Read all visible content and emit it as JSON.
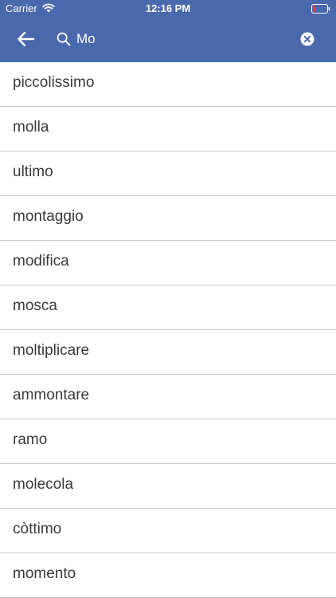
{
  "status_bar": {
    "carrier": "Carrier",
    "time": "12:16 PM"
  },
  "search": {
    "query": "Mo",
    "icons": {
      "back": "arrow-left-icon",
      "search": "search-icon",
      "clear": "clear-circle-icon"
    }
  },
  "results": [
    "piccolissimo",
    "molla",
    "ultimo",
    "montaggio",
    "modifica",
    "mosca",
    "moltiplicare",
    "ammontare",
    "ramo",
    "molecola",
    "còttimo",
    "momento"
  ],
  "colors": {
    "header": "#4a69ad",
    "text": "#3a3a3a",
    "divider": "#c8c8c8",
    "battery_low": "#e53935"
  }
}
